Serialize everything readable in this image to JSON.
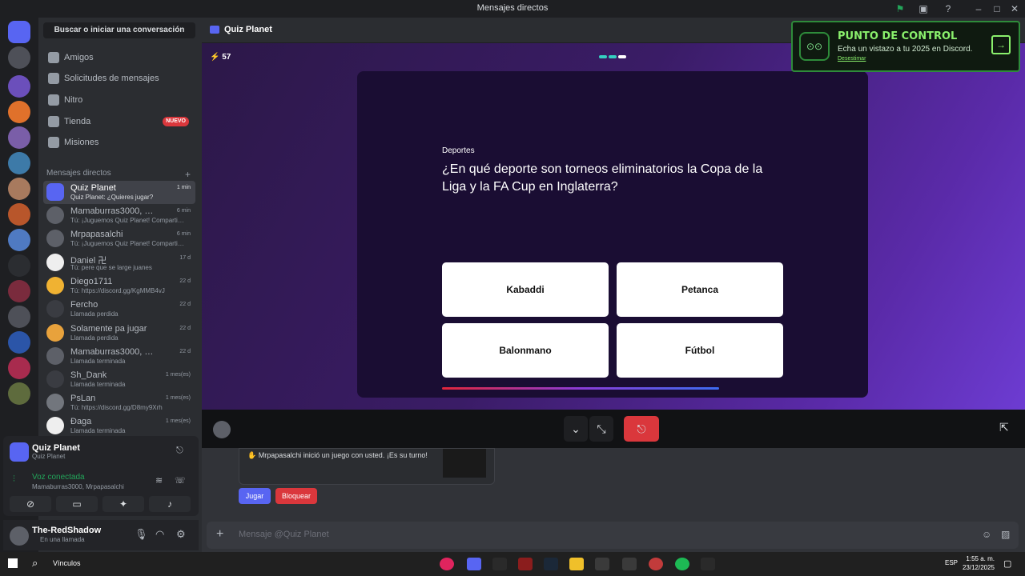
{
  "window": {
    "title": "Mensajes directos"
  },
  "sidebar": {
    "search_label": "Buscar o iniciar una conversación",
    "nav": [
      {
        "label": "Amigos",
        "icon": "friends-icon"
      },
      {
        "label": "Solicitudes de mensajes",
        "icon": "mail-icon"
      },
      {
        "label": "Nitro",
        "icon": "nitro-icon"
      },
      {
        "label": "Tienda",
        "icon": "shop-icon",
        "badge": "NUEVO"
      },
      {
        "label": "Misiones",
        "icon": "quest-icon"
      }
    ],
    "dm_header": "Mensajes directos",
    "dms": [
      {
        "name": "Quiz Planet",
        "sub": "Quiz Planet: ¿Quieres jugar?",
        "time": "1 min"
      },
      {
        "name": "Mamaburras3000, Mrpa...",
        "sub": "Tú: ¡Juguemos Quiz Planet! Compartido...",
        "time": "6 min"
      },
      {
        "name": "Mrpapasalchi",
        "sub": "Tú: ¡Juguemos Quiz Planet! Compartido...",
        "time": "6 min"
      },
      {
        "name": "Daniel 卍",
        "sub": "Tú: pere que se large juanes",
        "time": "17 d"
      },
      {
        "name": "Diego1711",
        "sub": "Tú: https://discord.gg/KgMMB4vJ",
        "time": "22 d"
      },
      {
        "name": "Fercho",
        "sub": "Llamada perdida",
        "time": "22 d"
      },
      {
        "name": "Solamente pa jugar",
        "sub": "Llamada perdida",
        "time": "22 d"
      },
      {
        "name": "Mamaburras3000, Sh_Da...",
        "sub": "Llamada terminada",
        "time": "22 d"
      },
      {
        "name": "Sh_Dank",
        "sub": "Llamada terminada",
        "time": "1 mes(es)"
      },
      {
        "name": "PsLan",
        "sub": "Tú: https://discord.gg/D8my9Xrh",
        "time": "1 mes(es)"
      },
      {
        "name": "Ðaga",
        "sub": "Llamada terminada",
        "time": "1 mes(es)"
      }
    ],
    "activity": {
      "title": "Quiz Planet",
      "subtitle": "Quiz Planet"
    },
    "voice": {
      "status": "Voz conectada",
      "members": "Mamaburras3000, Mrpapasalchi"
    },
    "user": {
      "name": "The-RedShadow",
      "status": "En una llamada"
    }
  },
  "header": {
    "title": "Quiz Planet"
  },
  "game": {
    "score": "57",
    "category": "Deportes",
    "question": "¿En qué deporte son torneos eliminatorios la Copa de la Liga y la FA Cup en Inglaterra?",
    "answers": [
      "Kabaddi",
      "Petanca",
      "Balonmano",
      "Fútbol"
    ]
  },
  "banner": {
    "title": "PUNTO DE CONTROL",
    "text": "Echa un vistazo a tu 2025 en Discord.",
    "link": "Desestimar"
  },
  "chat": {
    "message": "Mrpapasalchi inició un juego con usted. ¡Es su turno!",
    "play": "Jugar",
    "block": "Bloquear",
    "input_placeholder": "Mensaje @Quiz Planet"
  },
  "taskbar": {
    "search": "Vínculos",
    "lang": "ESP",
    "time": "1:55 a. m.",
    "date": "23/12/2025"
  },
  "colors": {
    "accent": "#5865f2",
    "danger": "#da373c",
    "green": "#23a55a"
  }
}
